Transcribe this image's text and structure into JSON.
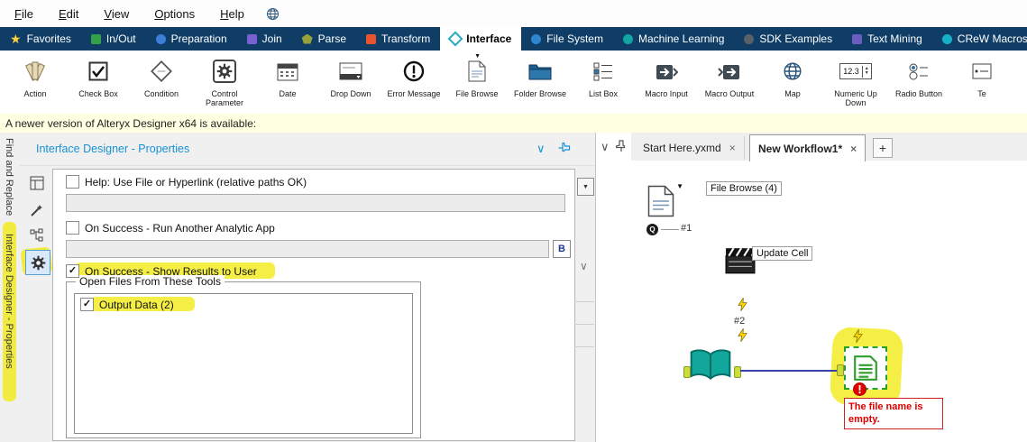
{
  "menu": {
    "items": [
      "File",
      "Edit",
      "View",
      "Options",
      "Help"
    ]
  },
  "palette": {
    "active_tab": "Interface",
    "tabs": [
      {
        "label": "Favorites"
      },
      {
        "label": "In/Out"
      },
      {
        "label": "Preparation"
      },
      {
        "label": "Join"
      },
      {
        "label": "Parse"
      },
      {
        "label": "Transform"
      },
      {
        "label": "Interface"
      },
      {
        "label": "File System"
      },
      {
        "label": "Machine Learning"
      },
      {
        "label": "SDK Examples"
      },
      {
        "label": "Text Mining"
      },
      {
        "label": "CReW Macros"
      }
    ]
  },
  "ribbon": {
    "tools": [
      {
        "label": "Action"
      },
      {
        "label": "Check Box"
      },
      {
        "label": "Condition"
      },
      {
        "label": "Control Parameter"
      },
      {
        "label": "Date"
      },
      {
        "label": "Drop Down"
      },
      {
        "label": "Error Message"
      },
      {
        "label": "File Browse"
      },
      {
        "label": "Folder Browse"
      },
      {
        "label": "List Box"
      },
      {
        "label": "Macro Input"
      },
      {
        "label": "Macro Output"
      },
      {
        "label": "Map"
      },
      {
        "label": "Numeric Up Down"
      },
      {
        "label": "Radio Button"
      },
      {
        "label": "Te"
      }
    ],
    "numeric_icon_text": "12.3"
  },
  "notice": {
    "text": "A newer version of Alteryx Designer x64 is available:"
  },
  "rail": {
    "items": [
      "Find and Replace",
      "Interface Designer - Properties"
    ]
  },
  "panel": {
    "title": "Interface Designer - Properties",
    "help_label": "Help: Use File or Hyperlink (relative paths OK)",
    "run_app_label": "On Success - Run Another Analytic App",
    "show_results_label": "On Success - Show Results to User",
    "group_title": "Open Files From These Tools",
    "output_item_label": "Output Data (2)",
    "browse_button_label": "B"
  },
  "canvas": {
    "tabs": [
      {
        "label": "Start Here.yxmd"
      },
      {
        "label": "New Workflow1*"
      }
    ],
    "file_browse_label": "File Browse (4)",
    "update_cell_label": "Update Cell",
    "annotation_1": "#1",
    "annotation_2": "#2",
    "error_tooltip": "The file name is empty."
  },
  "icons": {
    "star": "★",
    "chevron_down": "∨",
    "close": "×",
    "plus": "+",
    "dropdown_arrow": "▼",
    "check": "✓",
    "up_arrow": "▲",
    "down_arrow": "▼",
    "anchor_q": "Q"
  },
  "colors": {
    "highlight": "#f3eb16",
    "tabstrip_bg": "#0f3d66",
    "panel_accent": "#1792d2",
    "error_red": "#e00000",
    "connection_blue": "#3a3fae",
    "selection_green": "#1fa51f"
  }
}
